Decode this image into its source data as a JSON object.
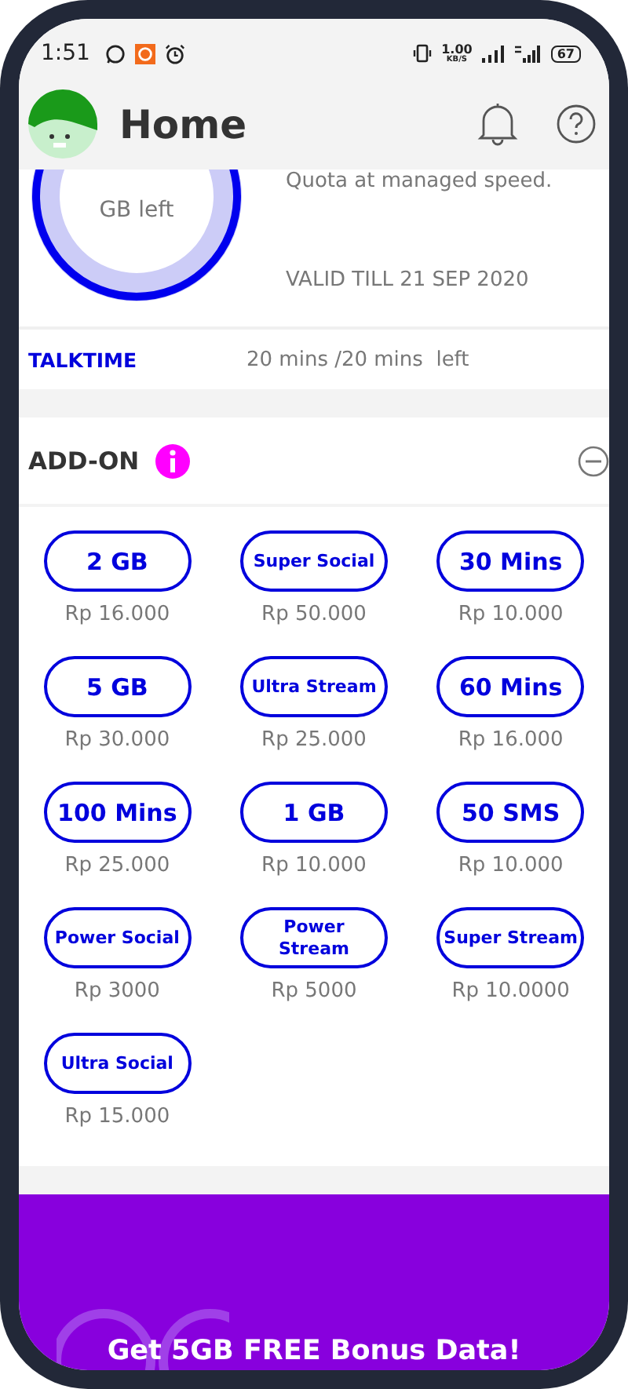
{
  "status_bar": {
    "time": "1:51",
    "speed_value": "1.00",
    "speed_unit": "KB/S",
    "battery": "67"
  },
  "header": {
    "title": "Home"
  },
  "data_quota": {
    "donut_label": "GB left",
    "note": "Quota at managed speed.",
    "validity": "VALID TILL 21 SEP 2020"
  },
  "talktime": {
    "label": "TALKTIME",
    "value": "20 mins /20 mins  left"
  },
  "addon": {
    "title": "ADD-ON",
    "expanded": true,
    "items": [
      {
        "name": "2 GB",
        "price": "Rp 16.000",
        "kind": "regular"
      },
      {
        "name": "Super Social",
        "price": "Rp 50.000",
        "kind": "compact"
      },
      {
        "name": "30 Mins",
        "price": "Rp 10.000",
        "kind": "regular"
      },
      {
        "name": "5 GB",
        "price": "Rp 30.000",
        "kind": "regular"
      },
      {
        "name": "Ultra Stream",
        "price": "Rp 25.000",
        "kind": "compact"
      },
      {
        "name": "60 Mins",
        "price": "Rp 16.000",
        "kind": "regular"
      },
      {
        "name": "100 Mins",
        "price": "Rp 25.000",
        "kind": "regular"
      },
      {
        "name": "1 GB",
        "price": "Rp 10.000",
        "kind": "regular"
      },
      {
        "name": "50 SMS",
        "price": "Rp 10.000",
        "kind": "regular"
      },
      {
        "name": "Power Social",
        "price": "Rp 3000",
        "kind": "compact"
      },
      {
        "name": "Power Stream",
        "price": "Rp 5000",
        "kind": "compact"
      },
      {
        "name": "Super Stream",
        "price": "Rp 10.0000",
        "kind": "compact"
      },
      {
        "name": "Ultra Social",
        "price": "Rp 15.000",
        "kind": "compact"
      }
    ]
  },
  "banner": {
    "title": "Get 5GB FREE Bonus Data!"
  }
}
